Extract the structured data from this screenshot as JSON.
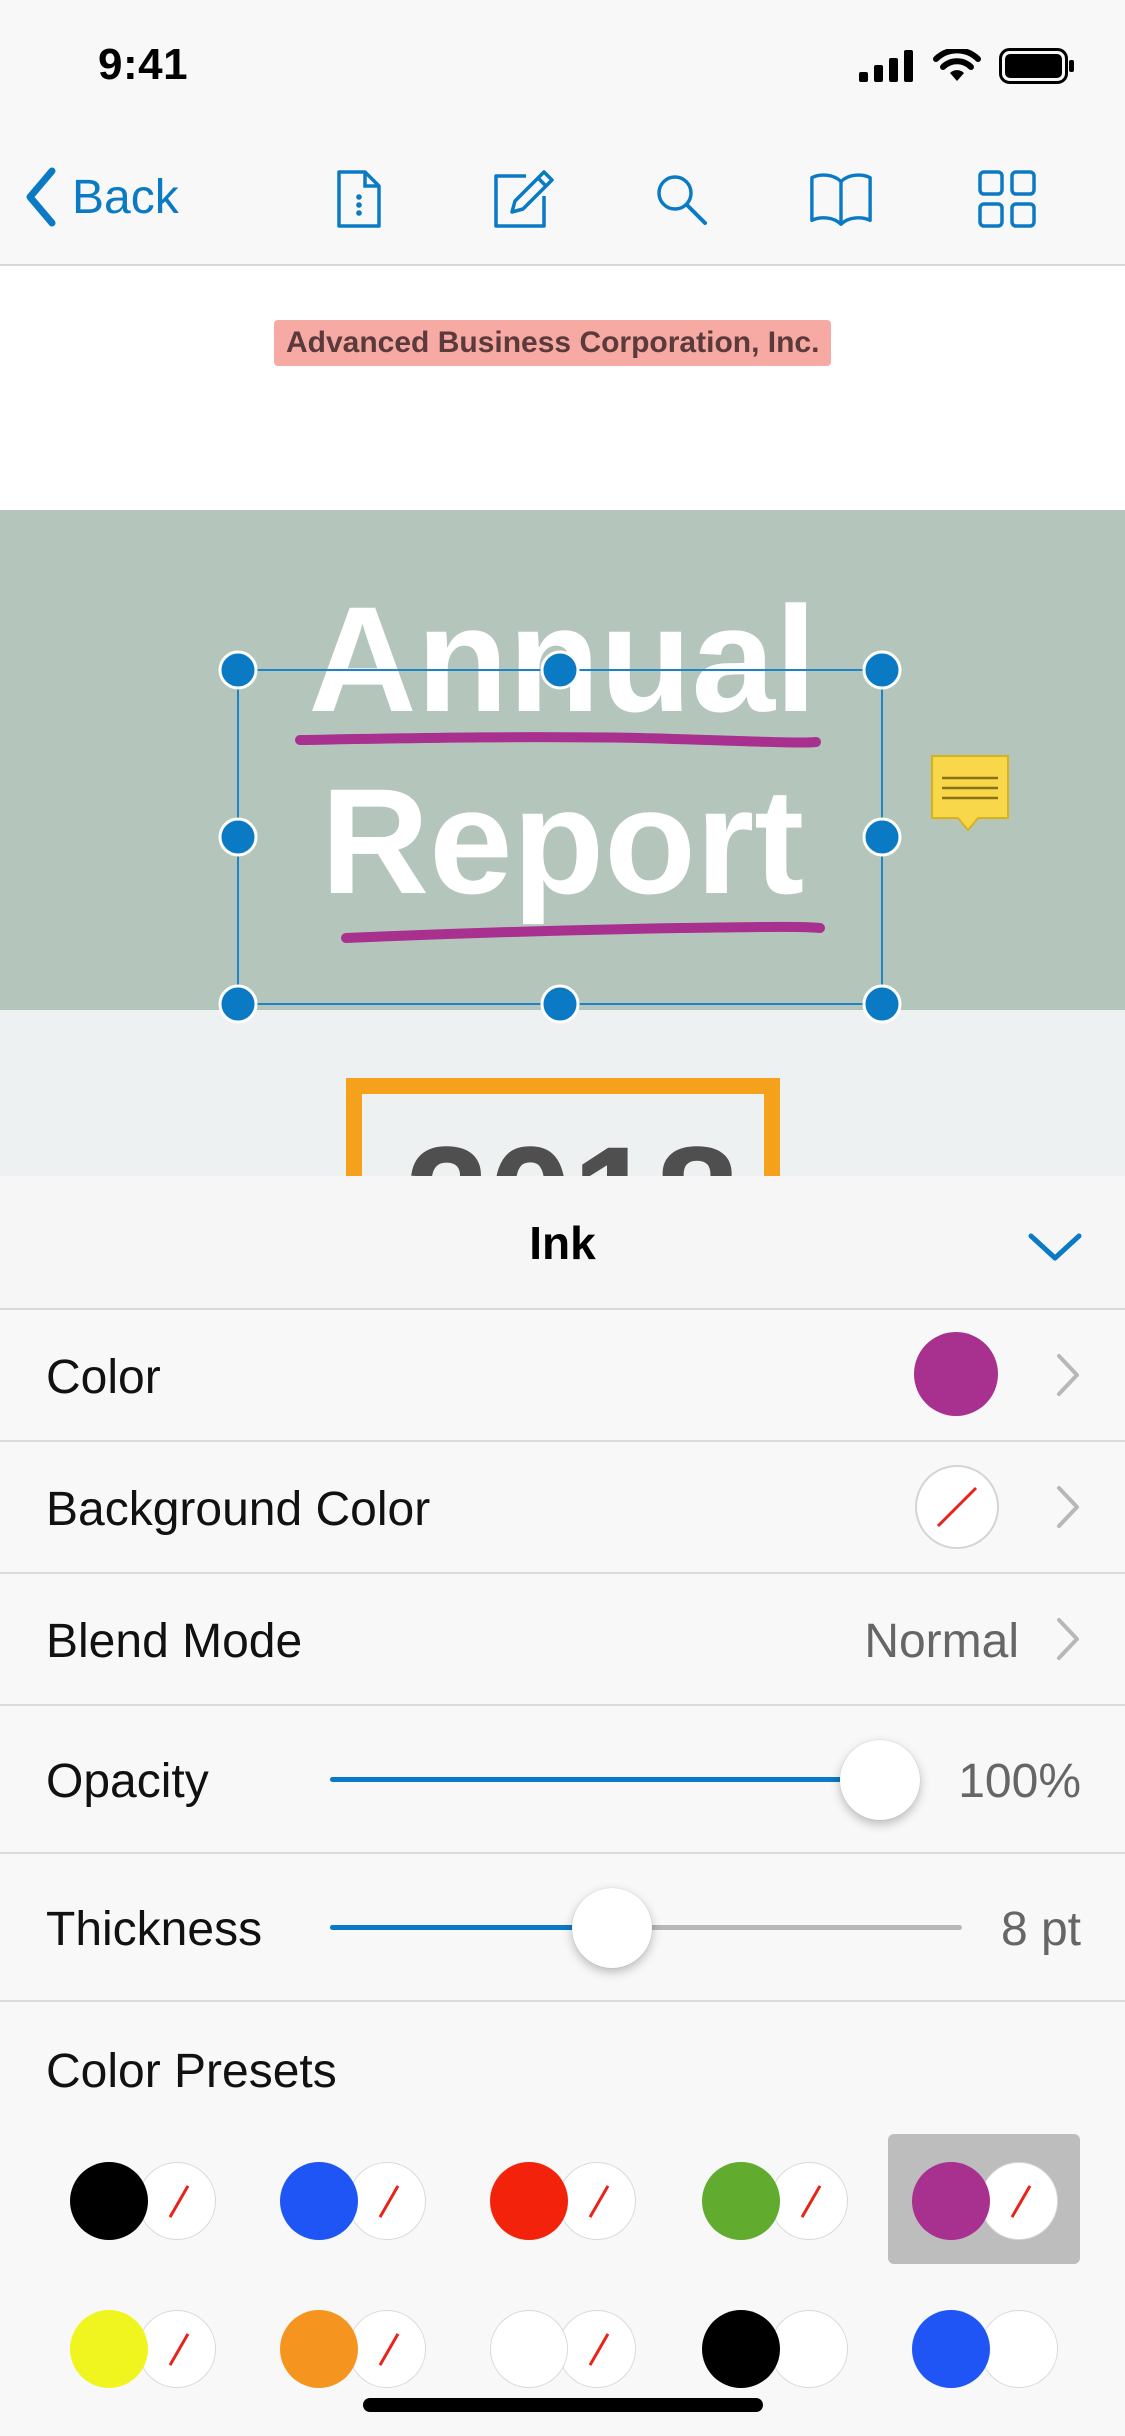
{
  "status": {
    "time": "9:41"
  },
  "nav": {
    "back_label": "Back"
  },
  "document": {
    "company": "Advanced Business Corporation, Inc.",
    "title_line1": "Annual",
    "title_line2": "Report",
    "year": "2018"
  },
  "panel": {
    "title": "Ink",
    "rows": {
      "color": {
        "label": "Color",
        "value_color": "#a8308f"
      },
      "background_color": {
        "label": "Background Color"
      },
      "blend_mode": {
        "label": "Blend Mode",
        "value": "Normal"
      },
      "opacity": {
        "label": "Opacity",
        "value": "100%",
        "level": 1.0
      },
      "thickness": {
        "label": "Thickness",
        "value": "8 pt",
        "level": 0.45
      }
    },
    "presets_label": "Color Presets",
    "presets": [
      {
        "fill": "#000000",
        "background": "none"
      },
      {
        "fill": "#1f55f5",
        "background": "none"
      },
      {
        "fill": "#f2230a",
        "background": "none"
      },
      {
        "fill": "#61ab2e",
        "background": "none"
      },
      {
        "fill": "#a8308f",
        "background": "none",
        "selected": true
      },
      {
        "fill": "#f1f51f",
        "background": "none"
      },
      {
        "fill": "#f5951f",
        "background": "none"
      },
      {
        "fill": "#ffffff",
        "background": "none"
      },
      {
        "fill": "#000000",
        "background": "#ffffff"
      },
      {
        "fill": "#1f55f5",
        "background": "#ffffff"
      }
    ]
  },
  "colors": {
    "accent": "#0a7ac4",
    "ink_purple": "#a8308f",
    "highlight": "#f7a9a4",
    "note": "#f8d84a"
  }
}
